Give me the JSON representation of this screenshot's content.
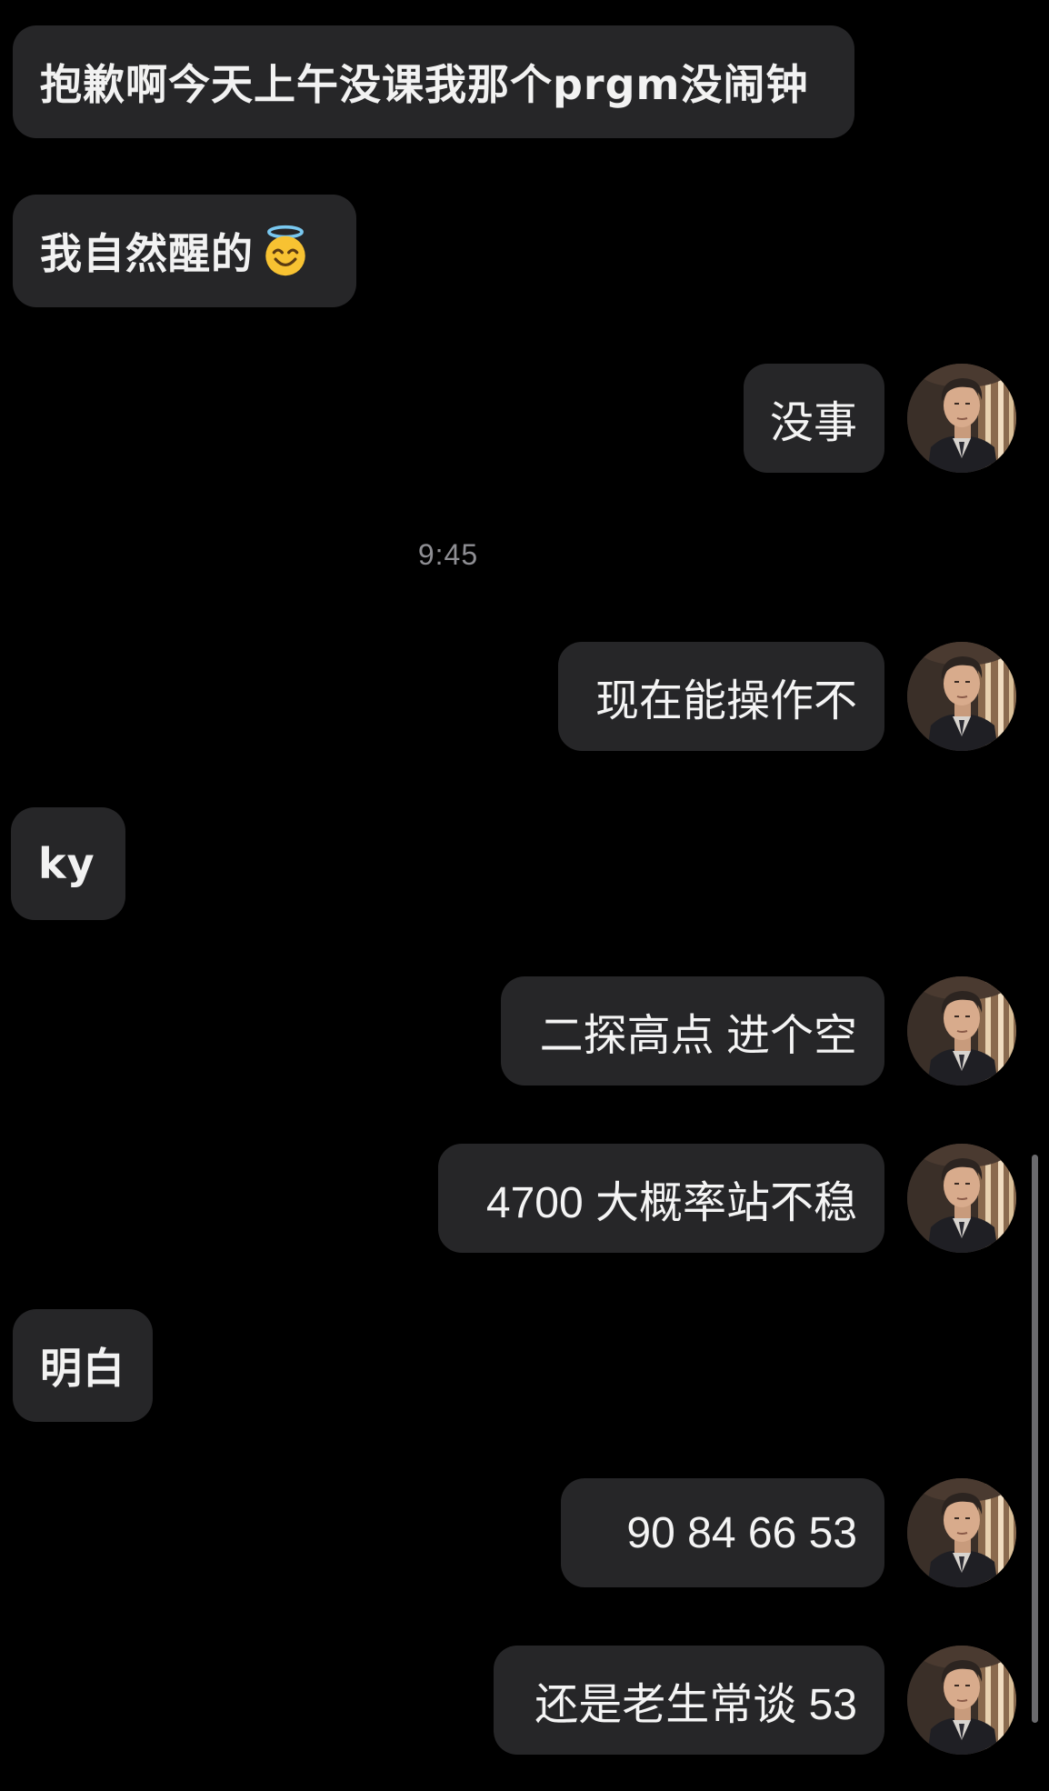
{
  "conversation": {
    "timestamp": "9:45",
    "messages": [
      {
        "side": "incoming",
        "text": "抱歉啊今天上午没课我那个prgm没闹钟"
      },
      {
        "side": "incoming",
        "text": "我自然醒的",
        "emoji": "smiling-face-with-halo"
      },
      {
        "side": "outgoing",
        "text": "没事"
      },
      {
        "side": "outgoing",
        "text": "现在能操作不"
      },
      {
        "side": "incoming",
        "text": "ky"
      },
      {
        "side": "outgoing",
        "text": "二探高点 进个空"
      },
      {
        "side": "outgoing",
        "text": "4700 大概率站不稳"
      },
      {
        "side": "incoming",
        "text": "明白"
      },
      {
        "side": "outgoing",
        "text": "90  84 66 53"
      },
      {
        "side": "outgoing",
        "text": "还是老生常谈 53"
      }
    ]
  },
  "colors": {
    "background": "#000000",
    "bubble": "#262628",
    "text": "#f4f4f4",
    "timestamp": "#8e8e93"
  }
}
